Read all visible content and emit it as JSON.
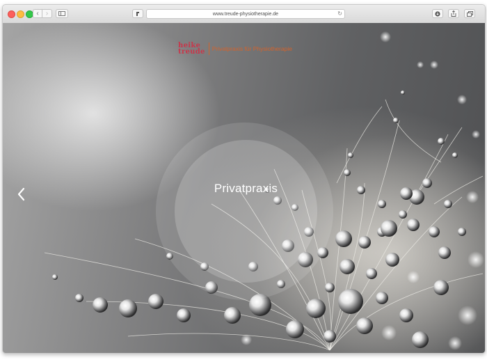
{
  "browser": {
    "url": "www.treude-physiotherapie.de"
  },
  "site": {
    "logo_line1": "heike",
    "logo_line2": "treude",
    "tagline": "Privatpraxis für Physiotherapie"
  },
  "hero": {
    "title": "Privatpraxis"
  },
  "colors": {
    "brand_red": "#c8374b",
    "brand_orange": "#d4632c"
  },
  "icons": [
    "back-icon",
    "forward-icon",
    "sidebar-icon",
    "share-extension-icon",
    "reload-icon",
    "download-icon",
    "share-icon",
    "tabs-icon",
    "chevron-left-icon"
  ]
}
